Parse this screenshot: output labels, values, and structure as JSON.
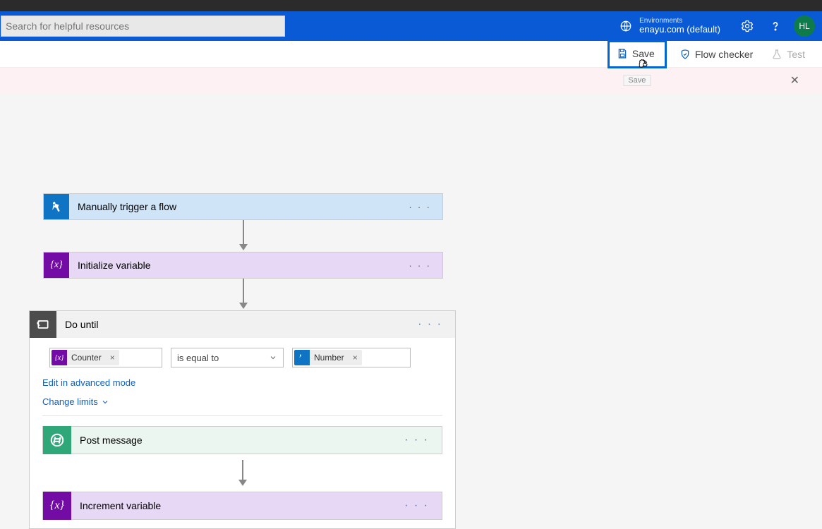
{
  "search": {
    "placeholder": "Search for helpful resources"
  },
  "env": {
    "label": "Environments",
    "name": "enayu.com (default)"
  },
  "avatar": {
    "initials": "HL"
  },
  "toolbar": {
    "save": "Save",
    "save_tooltip": "Save",
    "flow_checker": "Flow checker",
    "test": "Test"
  },
  "cards": {
    "trigger": "Manually trigger a flow",
    "init": "Initialize variable",
    "do_until": "Do until",
    "post": "Post message",
    "increment": "Increment variable"
  },
  "condition": {
    "left_token": "Counter",
    "operator": "is equal to",
    "right_token": "Number"
  },
  "links": {
    "edit_advanced": "Edit in advanced mode",
    "change_limits": "Change limits"
  }
}
